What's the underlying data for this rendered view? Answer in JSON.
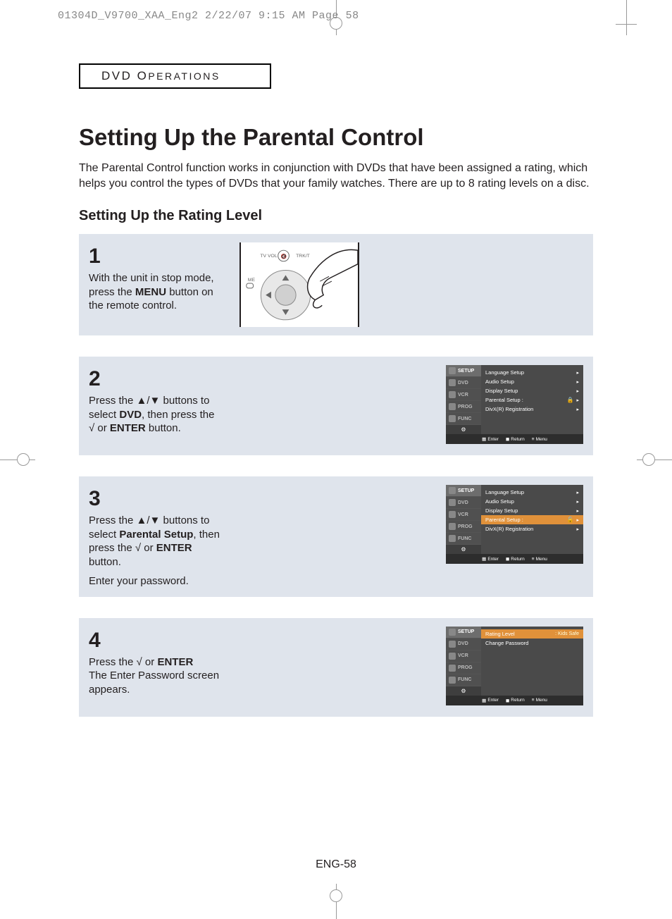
{
  "print_header": "01304D_V9700_XAA_Eng2  2/22/07  9:15 AM  Page 58",
  "section_label_main": "DVD O",
  "section_label_caps": "PERATIONS",
  "title": "Setting Up the Parental Control",
  "intro": "The Parental Control function works in conjunction with DVDs that have been assigned a rating, which helps you control the types of DVDs that your family watches. There are up to 8 rating levels on a disc.",
  "subheading": "Setting Up the Rating Level",
  "steps": {
    "s1": {
      "num": "1",
      "pre": "With the unit in stop mode, press the ",
      "bold": "MENU",
      "post": " button on the remote control."
    },
    "s2": {
      "num": "2",
      "line1a": "Press the ▲/▼ buttons to select ",
      "bold1": "DVD",
      "line1b": ", then press the √ or ",
      "bold2": "ENTER",
      "line1c": " button."
    },
    "s3": {
      "num": "3",
      "line1a": "Press the ▲/▼ buttons to select ",
      "bold1": "Parental Setup",
      "line1b": ", then press the √ or ",
      "bold2": "ENTER",
      "line1c": " button.",
      "line2": "Enter your password."
    },
    "s4": {
      "num": "4",
      "line1a": "Press the √ or ",
      "bold1": "ENTER",
      "line2": "The Enter Password screen appears."
    }
  },
  "osd": {
    "tabs": [
      "SETUP",
      "DVD",
      "VCR",
      "PROG",
      "FUNC"
    ],
    "menu2": {
      "items": [
        "Language Setup",
        "Audio Setup",
        "Display Setup",
        "Parental Setup :",
        "DivX(R) Registration"
      ],
      "lock_on": "Parental Setup :"
    },
    "menu3": {
      "items": [
        "Language Setup",
        "Audio Setup",
        "Display Setup",
        "Parental Setup :",
        "DivX(R) Registration"
      ],
      "selected": "Parental Setup :"
    },
    "menu4": {
      "items": [
        {
          "label": "Rating Level",
          "value": ": Kids Safe",
          "sel": true
        },
        {
          "label": "Change Password",
          "value": "",
          "sel": false
        }
      ]
    },
    "footer": {
      "enter": "Enter",
      "return": "Return",
      "menu": "Menu"
    }
  },
  "page_num": "ENG-58"
}
